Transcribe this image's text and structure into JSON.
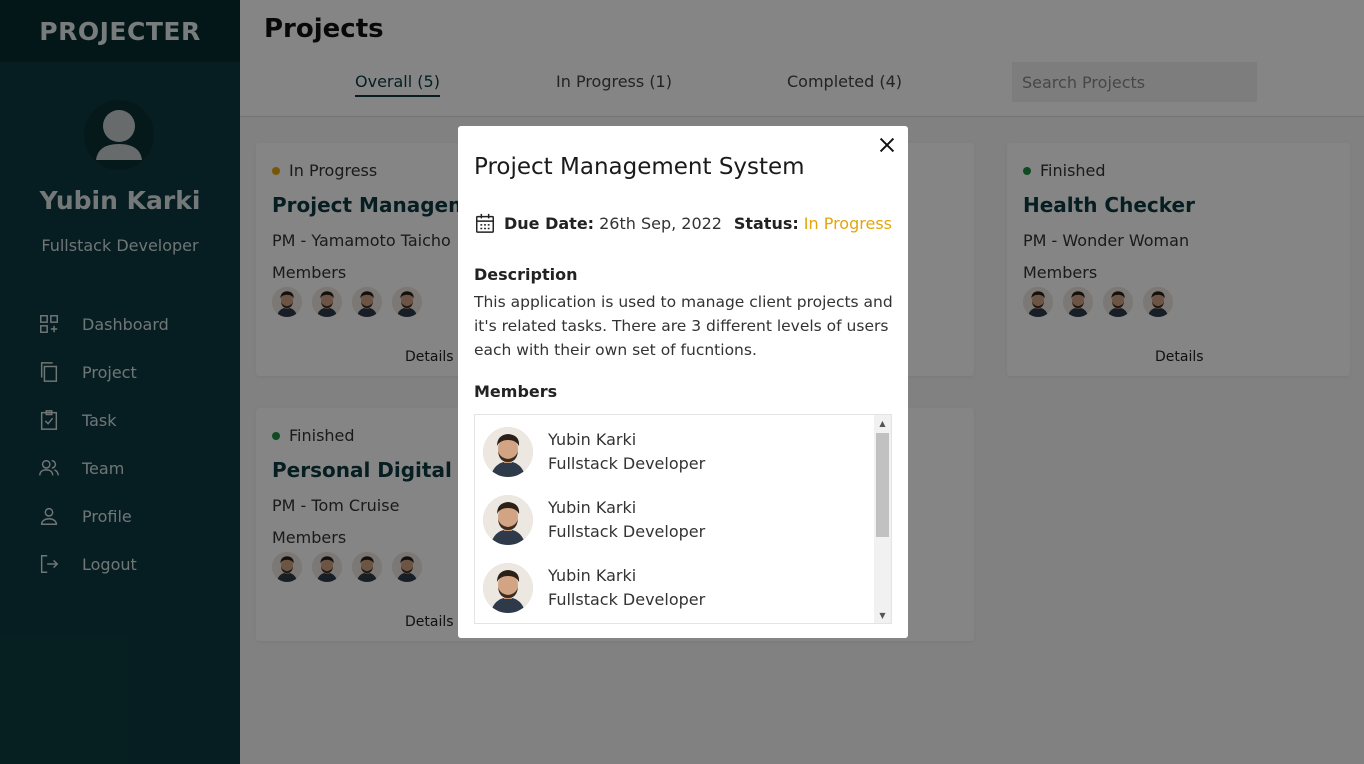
{
  "sidebar": {
    "brand": "PROJECTER",
    "user_name": "Yubin Karki",
    "user_role": "Fullstack Developer",
    "items": [
      {
        "label": "Dashboard",
        "icon": "dashboard-icon"
      },
      {
        "label": "Project",
        "icon": "copy-icon"
      },
      {
        "label": "Task",
        "icon": "task-icon"
      },
      {
        "label": "Team",
        "icon": "team-icon"
      },
      {
        "label": "Profile",
        "icon": "profile-icon"
      },
      {
        "label": "Logout",
        "icon": "logout-icon"
      }
    ]
  },
  "header": {
    "title": "Projects",
    "tabs": [
      {
        "label": "Overall (5)",
        "active": true
      },
      {
        "label": "In Progress (1)",
        "active": false
      },
      {
        "label": "Completed (4)",
        "active": false
      }
    ],
    "search_placeholder": "Search Projects"
  },
  "cards": [
    {
      "status": "In Progress",
      "status_color": "#e5a50a",
      "title": "Project Management System",
      "pm": "PM - Yamamoto Taicho",
      "members_label": "Members",
      "details": "Details"
    },
    {
      "status": "Finished",
      "status_color": "#1e8e3e",
      "title": "Health Checker",
      "pm": "PM - Wonder Woman",
      "members_label": "Members",
      "details": "Details"
    },
    {
      "status": "Finished",
      "status_color": "#1e8e3e",
      "title": "Personal Digital Wallet",
      "pm": "PM - Tom Cruise",
      "members_label": "Members",
      "details": "Details"
    }
  ],
  "modal": {
    "title": "Project Management System",
    "due_label": "Due Date:",
    "due_value": "26th Sep, 2022",
    "status_label": "Status:",
    "status_value": "In Progress",
    "status_color": "#e5a50a",
    "description_label": "Description",
    "description": "This application is used to manage client projects and it's related tasks. There are 3 different levels of users each with their own set of fucntions.",
    "members_label": "Members",
    "members": [
      {
        "name": "Yubin Karki",
        "role": "Fullstack Developer"
      },
      {
        "name": "Yubin Karki",
        "role": "Fullstack Developer"
      },
      {
        "name": "Yubin Karki",
        "role": "Fullstack Developer"
      }
    ]
  }
}
